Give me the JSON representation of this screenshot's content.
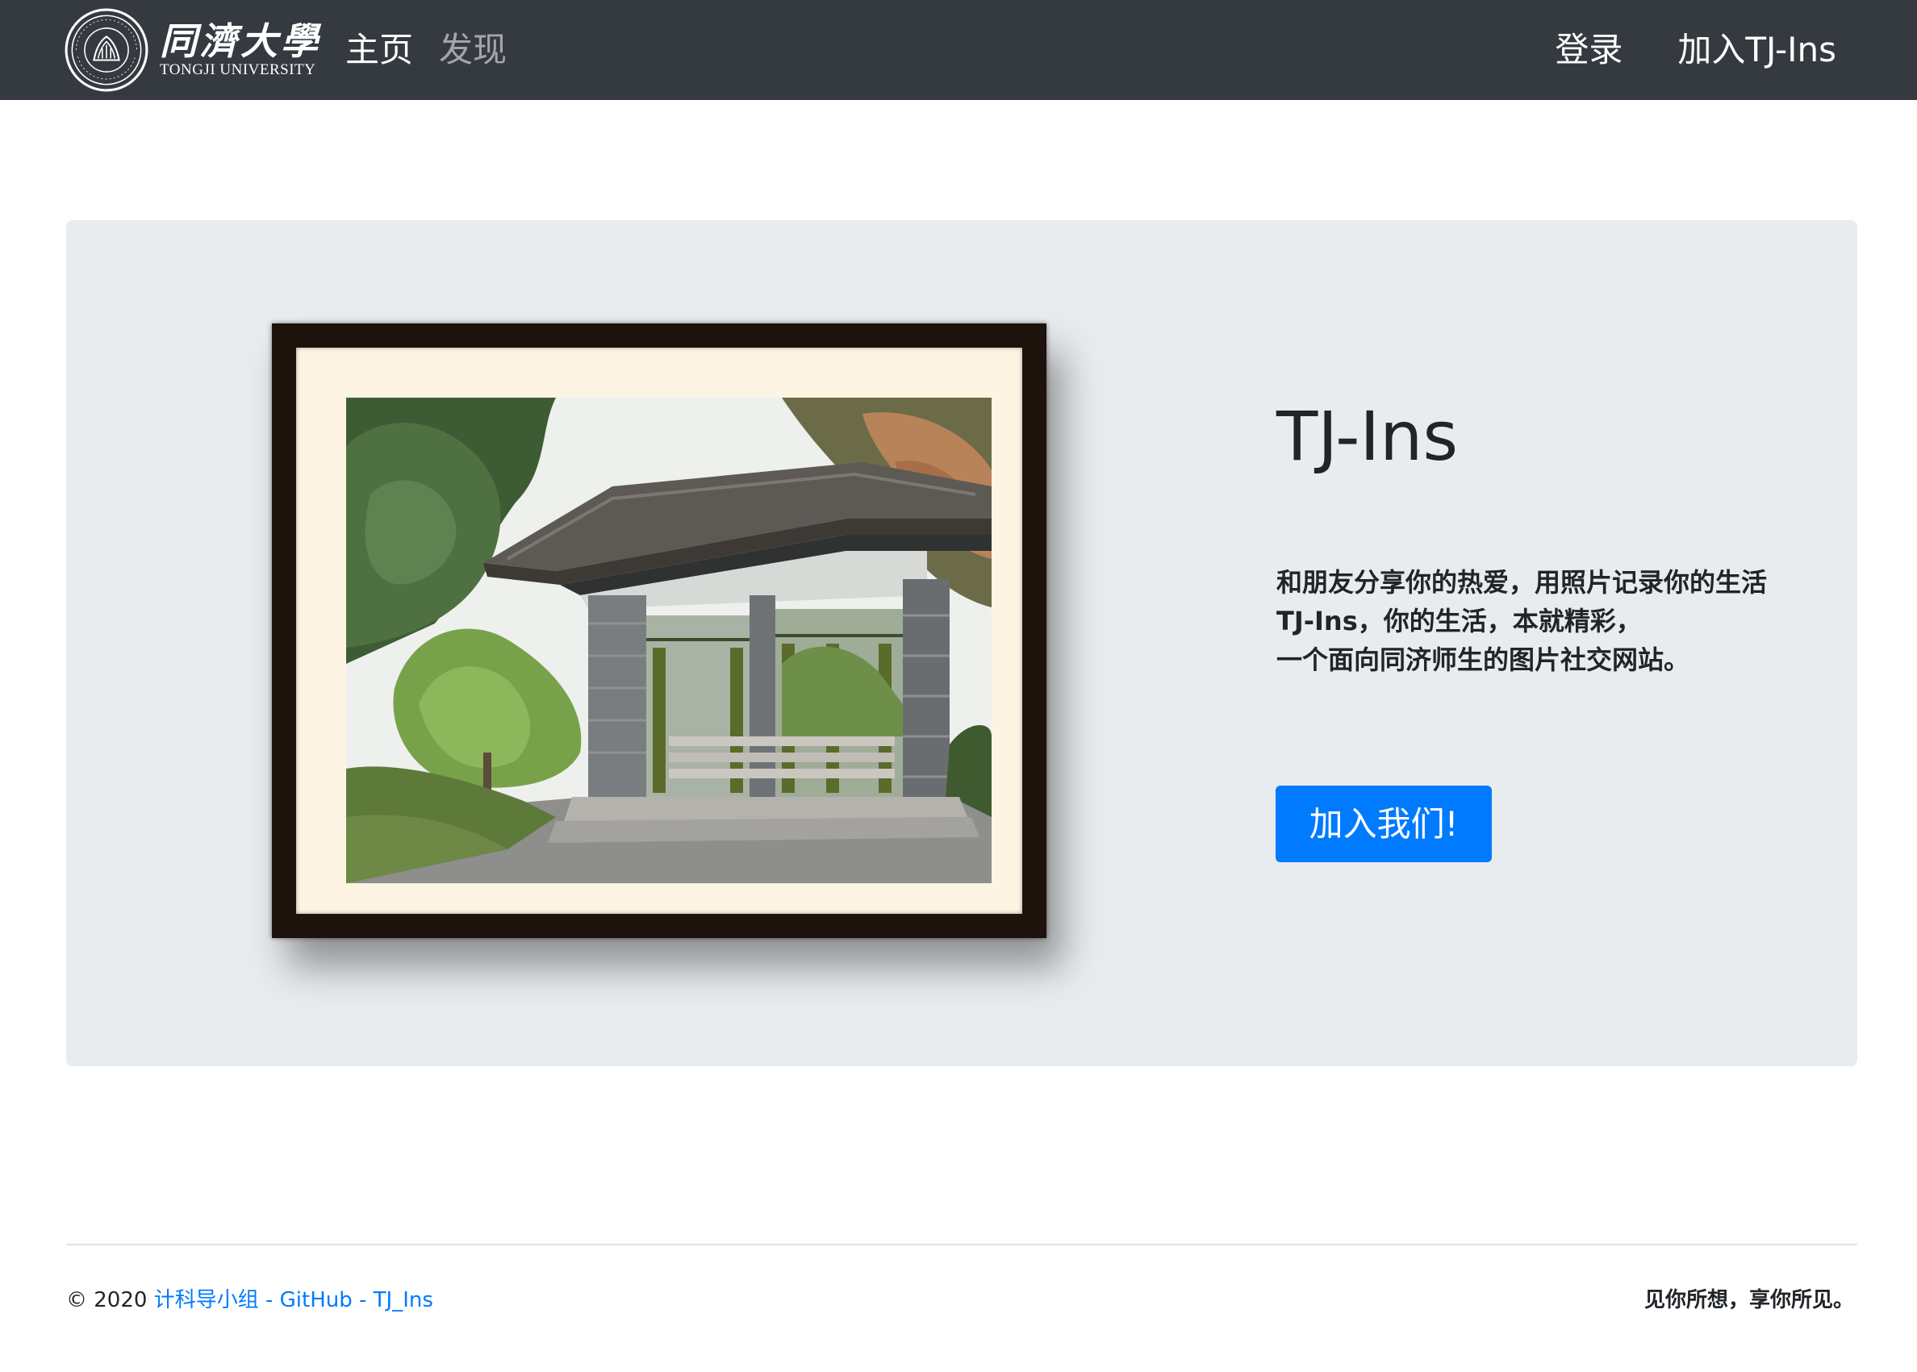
{
  "colors": {
    "navbar_bg": "#343a40",
    "jumbotron_bg": "#e9ecef",
    "primary": "#007bff",
    "frame": "#1e120d",
    "mat": "#fdf4e4"
  },
  "navbar": {
    "brand": {
      "name_cn": "同濟大學",
      "name_en": "TONGJI UNIVERSITY",
      "seal_icon": "tongji-university-seal"
    },
    "links_left": [
      {
        "label": "主页",
        "state": "active"
      },
      {
        "label": "发现",
        "state": "inactive"
      }
    ],
    "links_right": [
      {
        "label": "登录"
      },
      {
        "label": "加入TJ-Ins"
      }
    ]
  },
  "hero": {
    "image": "framed photo of a traditional gate pavilion among trees",
    "title": "TJ-Ins",
    "lines": [
      "和朋友分享你的热爱，用照片记录你的生活",
      "TJ-Ins，你的生活，本就精彩，",
      "一个面向同济师生的图片社交网站。"
    ],
    "button_label": "加入我们!"
  },
  "footer": {
    "copyright": "© 2020",
    "team_link": "计科导小组",
    "separator": "-",
    "github_link": "GitHub",
    "project_link": "TJ_Ins",
    "slogan": "见你所想，享你所见。"
  }
}
